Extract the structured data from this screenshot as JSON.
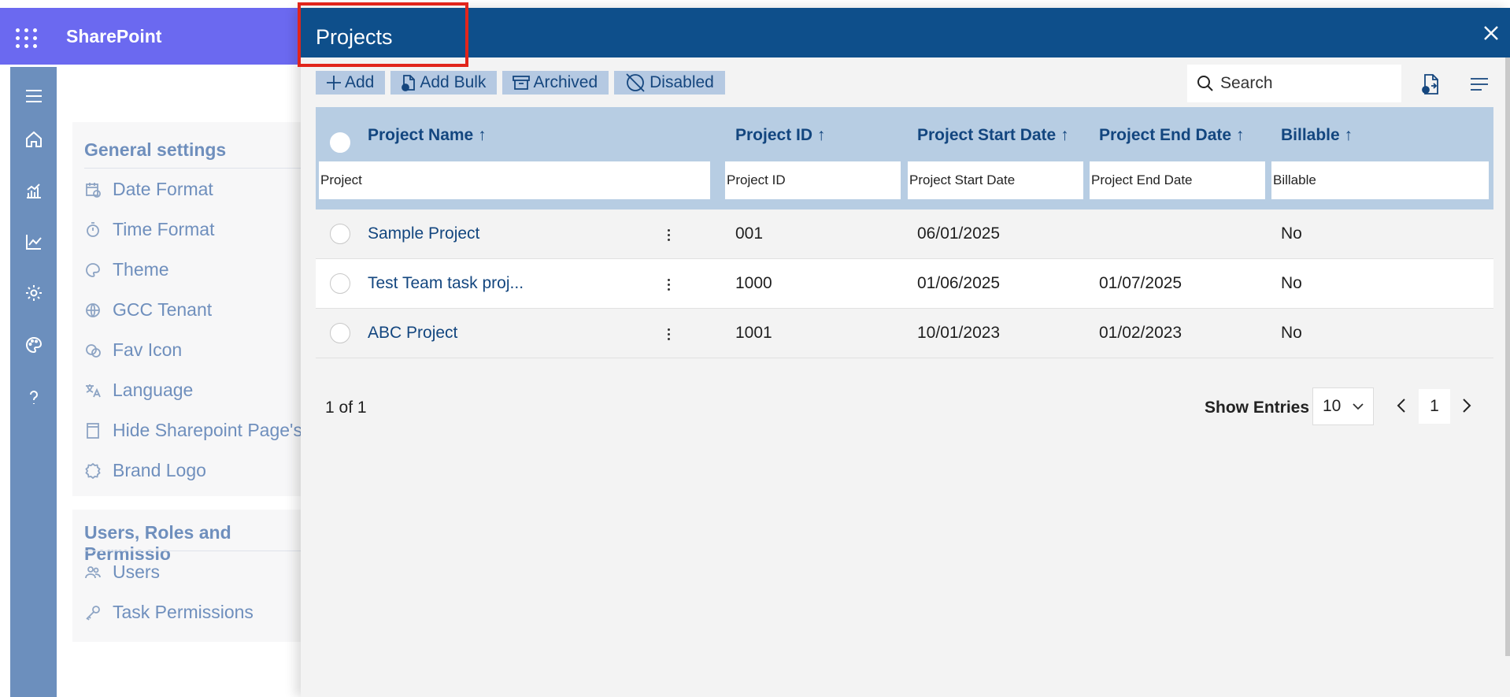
{
  "suitebar": {
    "app_name": "SharePoint",
    "color": "#6b69f0"
  },
  "rail": {
    "icons": [
      "menu-icon",
      "home-icon",
      "reports-icon",
      "analytics-icon",
      "settings-icon",
      "palette-icon",
      "help-icon"
    ]
  },
  "settings": {
    "general_title": "General settings",
    "general_items": [
      {
        "label": "Date Format",
        "icon": "calendar-icon"
      },
      {
        "label": "Time Format",
        "icon": "stopwatch-icon"
      },
      {
        "label": "Theme",
        "icon": "palette-icon"
      },
      {
        "label": "GCC Tenant",
        "icon": "globe-icon"
      },
      {
        "label": "Fav Icon",
        "icon": "favicon-icon"
      },
      {
        "label": "Language",
        "icon": "translate-icon"
      },
      {
        "label": "Hide Sharepoint Page's",
        "icon": "page-icon"
      },
      {
        "label": "Brand Logo",
        "icon": "badge-icon"
      }
    ],
    "users_title": "Users, Roles and Permissio",
    "users_items": [
      {
        "label": "Users",
        "icon": "people-icon"
      },
      {
        "label": "Task Permissions",
        "icon": "key-icon"
      }
    ]
  },
  "dialog": {
    "title": "Projects",
    "header_color": "#0e4f8b",
    "highlight_color": "#e1251b",
    "toolbar": {
      "add": "Add",
      "add_bulk": "Add Bulk",
      "archived": "Archived",
      "disabled": "Disabled"
    },
    "search_placeholder": "Search",
    "columns": [
      {
        "label": "Project Name",
        "sort": "↑",
        "filter_placeholder": "Project"
      },
      {
        "label": "Project ID",
        "sort": "↑",
        "filter_placeholder": "Project ID"
      },
      {
        "label": "Project Start Date",
        "sort": "↑",
        "filter_placeholder": "Project Start Date"
      },
      {
        "label": "Project End Date",
        "sort": "↑",
        "filter_placeholder": "Project End Date"
      },
      {
        "label": "Billable",
        "sort": "↑",
        "filter_placeholder": "Billable"
      }
    ],
    "rows": [
      {
        "name": "Sample Project",
        "id": "001",
        "start": "06/01/2025",
        "end": "",
        "billable": "No"
      },
      {
        "name": "Test Team task proj...",
        "id": "1000",
        "start": "01/06/2025",
        "end": "01/07/2025",
        "billable": "No"
      },
      {
        "name": "ABC Project",
        "id": "1001",
        "start": "10/01/2023",
        "end": "01/02/2023",
        "billable": "No"
      }
    ],
    "pagination": {
      "count_text": "1 of 1",
      "show_entries_label": "Show Entries",
      "entries_value": "10",
      "current_page": "1"
    }
  }
}
